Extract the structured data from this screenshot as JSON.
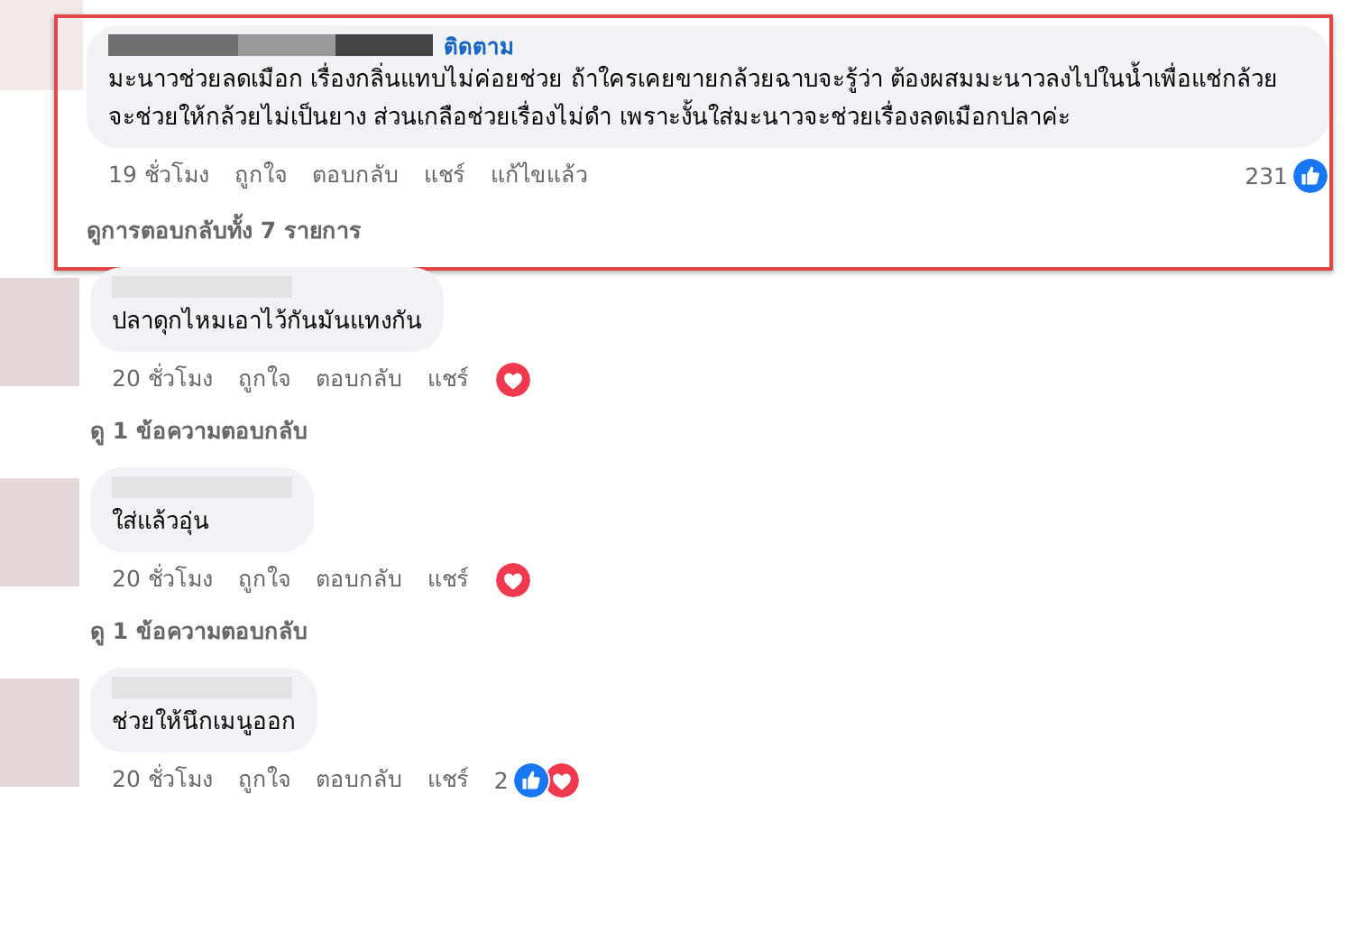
{
  "comments": [
    {
      "follow": "ติดตาม",
      "text": "มะนาวช่วยลดเมือก เรื่องกลิ่นแทบไม่ค่อยช่วย ถ้าใครเคยขายกล้วยฉาบจะรู้ว่า ต้องผสมมะนาวลงไปในน้ำเพื่อแช่กล้วย จะช่วยให้กล้วยไม่เป็นยาง ส่วนเกลือช่วยเรื่องไม่ดำ เพราะงั้นใส่มะนาวจะช่วยเรื่องลดเมือกปลาค่ะ",
      "highlighted": true,
      "actions": [
        "19 ชั่วโมง",
        "ถูกใจ",
        "ตอบกลับ",
        "แชร์",
        "แก้ไขแล้ว"
      ],
      "reaction_count": "231",
      "reactions": [
        {
          "kind": "like"
        }
      ],
      "replies_link": "ดูการตอบกลับทั้ง 7 รายการ"
    },
    {
      "text": "ปลาดุกไหมเอาไว้กันมันแทงกัน",
      "highlighted": false,
      "actions": [
        "20 ชั่วโมง",
        "ถูกใจ",
        "ตอบกลับ",
        "แชร์"
      ],
      "reactions": [
        {
          "kind": "love"
        }
      ],
      "replies_link": "ดู 1 ข้อความตอบกลับ"
    },
    {
      "text": "ใส่แล้วอุ่น",
      "highlighted": false,
      "actions": [
        "20 ชั่วโมง",
        "ถูกใจ",
        "ตอบกลับ",
        "แชร์"
      ],
      "reactions": [
        {
          "kind": "love"
        }
      ],
      "replies_link": "ดู 1 ข้อความตอบกลับ"
    },
    {
      "text": "ช่วยให้นึกเมนูออก",
      "highlighted": false,
      "actions": [
        "20 ชั่วโมง",
        "ถูกใจ",
        "ตอบกลับ",
        "แชร์"
      ],
      "reaction_count": "2",
      "reactions": [
        {
          "kind": "like"
        },
        {
          "kind": "love"
        }
      ]
    }
  ]
}
